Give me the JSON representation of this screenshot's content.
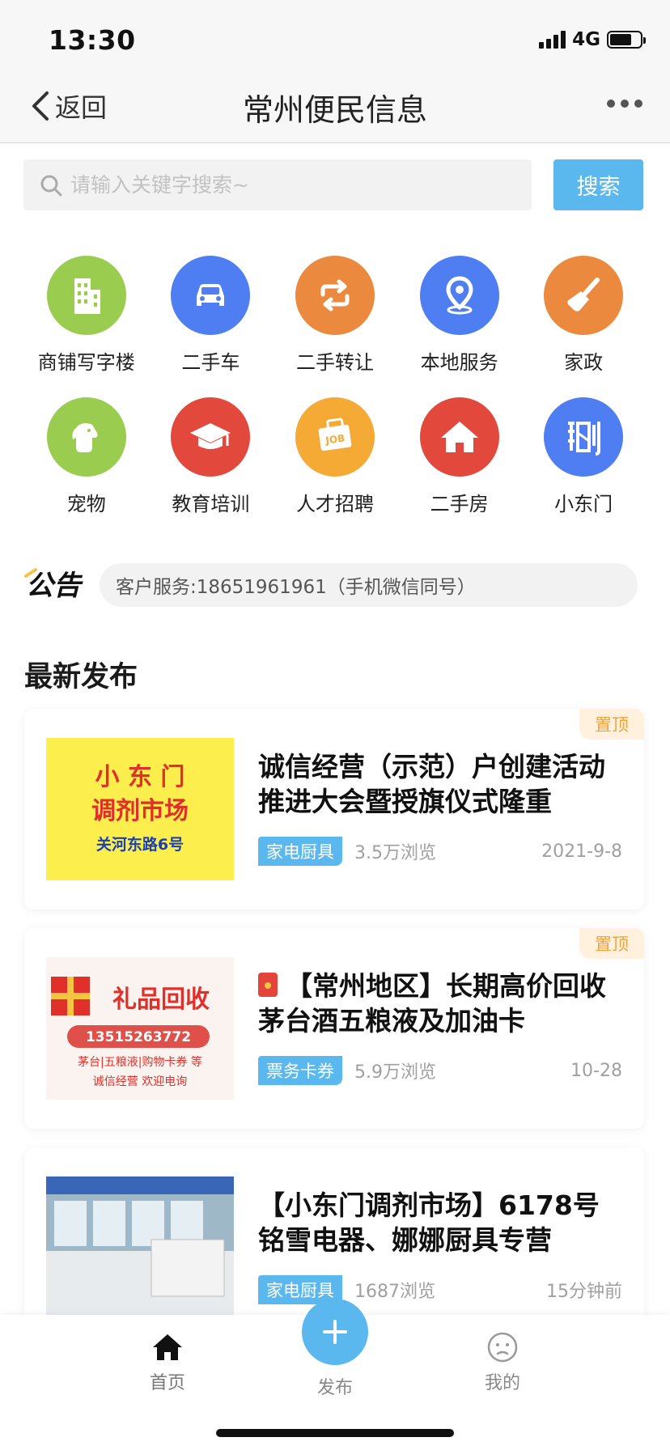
{
  "status_bar": {
    "time": "13:30",
    "network": "4G"
  },
  "nav": {
    "back_label": "返回",
    "title": "常州便民信息"
  },
  "search": {
    "placeholder": "请输入关键字搜索~",
    "button_label": "搜索"
  },
  "categories": [
    {
      "label": "商铺写字楼",
      "icon": "building-icon",
      "color": "#9acd4f"
    },
    {
      "label": "二手车",
      "icon": "car-icon",
      "color": "#4f7ef2"
    },
    {
      "label": "二手转让",
      "icon": "swap-icon",
      "color": "#eb8a3f"
    },
    {
      "label": "本地服务",
      "icon": "location-icon",
      "color": "#4f7ef2"
    },
    {
      "label": "家政",
      "icon": "broom-icon",
      "color": "#eb8a3f"
    },
    {
      "label": "宠物",
      "icon": "dog-icon",
      "color": "#9acd4f"
    },
    {
      "label": "教育培训",
      "icon": "graduation-cap-icon",
      "color": "#e2493c"
    },
    {
      "label": "人才招聘",
      "icon": "job-icon",
      "color": "#f5aa36"
    },
    {
      "label": "二手房",
      "icon": "house-icon",
      "color": "#e2493c"
    },
    {
      "label": "小东门",
      "icon": "xiaodongmen-logo-icon",
      "color": "#4f7ef2"
    }
  ],
  "notice": {
    "badge": "公告",
    "text": "客户服务:18651961961（手机微信同号）"
  },
  "section_title": "最新发布",
  "posts": [
    {
      "title": "诚信经营（示范）户创建活动推进大会暨授旗仪式隆重",
      "tag": "家电厨具",
      "views": "3.5万浏览",
      "date": "2021-9-8",
      "pinned": "置顶",
      "thumb_lines": [
        "小 东 门",
        "调剂市场",
        "关河东路6号"
      ]
    },
    {
      "title": "【常州地区】长期高价回收茅台酒五粮液及加油卡",
      "tag": "票务卡券",
      "views": "5.9万浏览",
      "date": "10-28",
      "pinned": "置顶",
      "thumb_lines": [
        "礼品回收",
        "13515263772",
        "茅台|五粮液|购物卡券 等",
        "诚信经营    欢迎电询"
      ]
    },
    {
      "title": "【小东门调剂市场】6178号铭雪电器、娜娜厨具专营",
      "tag": "家电厨具",
      "views": "1687浏览",
      "date": "15分钟前",
      "thumb_lines": []
    }
  ],
  "tabbar": {
    "home": "首页",
    "publish": "发布",
    "mine": "我的"
  },
  "colors": {
    "accent": "#5bb8ee",
    "pin_text": "#f0a43a",
    "pin_bg": "#fff1dd"
  }
}
